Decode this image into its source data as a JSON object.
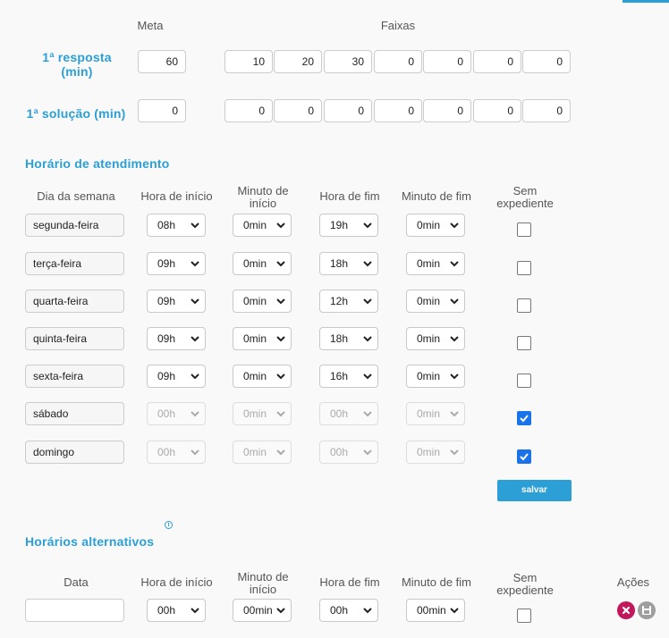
{
  "goals": {
    "meta_header": "Meta",
    "faixas_header": "Faixas",
    "rows": [
      {
        "label_line1": "1ª resposta",
        "label_line2": "(min)",
        "meta": "60",
        "faixas": [
          "10",
          "20",
          "30",
          "0",
          "0",
          "0",
          "0"
        ]
      },
      {
        "label_line1": "1ª solução (min)",
        "label_line2": "",
        "meta": "0",
        "faixas": [
          "0",
          "0",
          "0",
          "0",
          "0",
          "0",
          "0"
        ]
      }
    ]
  },
  "schedule": {
    "title": "Horário de atendimento",
    "headers": {
      "day": "Dia da semana",
      "start_hour": "Hora de início",
      "start_min_1": "Minuto de",
      "start_min_2": "início",
      "end_hour": "Hora de fim",
      "end_min": "Minuto de fim",
      "no_shift_1": "Sem",
      "no_shift_2": "expediente"
    },
    "rows": [
      {
        "day": "segunda-feira",
        "start_hour": "08h",
        "start_min": "0min",
        "end_hour": "19h",
        "end_min": "0min",
        "no_shift": false
      },
      {
        "day": "terça-feira",
        "start_hour": "09h",
        "start_min": "0min",
        "end_hour": "18h",
        "end_min": "0min",
        "no_shift": false
      },
      {
        "day": "quarta-feira",
        "start_hour": "09h",
        "start_min": "0min",
        "end_hour": "12h",
        "end_min": "0min",
        "no_shift": false
      },
      {
        "day": "quinta-feira",
        "start_hour": "09h",
        "start_min": "0min",
        "end_hour": "18h",
        "end_min": "0min",
        "no_shift": false
      },
      {
        "day": "sexta-feira",
        "start_hour": "09h",
        "start_min": "0min",
        "end_hour": "16h",
        "end_min": "0min",
        "no_shift": false
      },
      {
        "day": "sábado",
        "start_hour": "00h",
        "start_min": "0min",
        "end_hour": "00h",
        "end_min": "0min",
        "no_shift": true
      },
      {
        "day": "domingo",
        "start_hour": "00h",
        "start_min": "0min",
        "end_hour": "00h",
        "end_min": "0min",
        "no_shift": true
      }
    ],
    "save_label": "salvar"
  },
  "alternative": {
    "title": "Horários alternativos",
    "info_icon": "i",
    "headers": {
      "date": "Data",
      "start_hour": "Hora de início",
      "start_min_1": "Minuto de",
      "start_min_2": "início",
      "end_hour": "Hora de fim",
      "end_min": "Minuto de fim",
      "no_shift_1": "Sem",
      "no_shift_2": "expediente",
      "actions": "Ações"
    },
    "row": {
      "date": "",
      "start_hour": "00h",
      "start_min": "00min",
      "end_hour": "00h",
      "end_min": "00min",
      "no_shift": false
    }
  },
  "colors": {
    "accent": "#2b9fd6",
    "checkbox_checked": "#1a73e8",
    "delete_button": "#c2185b",
    "save_icon_button": "#9e9e9e"
  },
  "icons": {
    "chevron": "chevron-down-icon",
    "delete": "close-icon",
    "save": "floppy-disk-icon",
    "info": "info-icon"
  }
}
